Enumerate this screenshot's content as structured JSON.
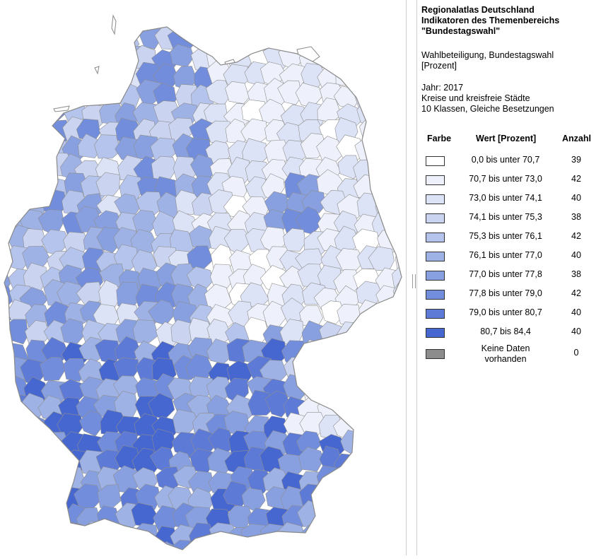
{
  "header": {
    "title_lines": [
      "Regionalatlas Deutschland",
      "Indikatoren des Themenbereichs",
      "\"Bundestagswahl\""
    ],
    "indicator_lines": [
      "Wahlbeteiligung, Bundestagswahl",
      "[Prozent]"
    ],
    "meta_lines": [
      "Jahr: 2017",
      "Kreise und kreisfreie Städte",
      "10 Klassen, Gleiche Besetzungen"
    ]
  },
  "legend": {
    "col_color": "Farbe",
    "col_value": "Wert [Prozent]",
    "col_count": "Anzahl",
    "classes": [
      {
        "label": "0,0 bis unter 70,7",
        "count": "39",
        "color": "#ffffff"
      },
      {
        "label": "70,7 bis unter 73,0",
        "count": "42",
        "color": "#eef1fb"
      },
      {
        "label": "73,0 bis unter 74,1",
        "count": "40",
        "color": "#dde3f6"
      },
      {
        "label": "74,1 bis unter 75,3",
        "count": "38",
        "color": "#cad4f1"
      },
      {
        "label": "75,3 bis unter 76,1",
        "count": "42",
        "color": "#b5c4ec"
      },
      {
        "label": "76,1 bis unter 77,0",
        "count": "40",
        "color": "#9fb2e6"
      },
      {
        "label": "77,0 bis unter 77,8",
        "count": "38",
        "color": "#88a0e0"
      },
      {
        "label": "77,8 bis unter 79,0",
        "count": "42",
        "color": "#728ddb"
      },
      {
        "label": "79,0 bis unter 80,7",
        "count": "40",
        "color": "#5c7ad6"
      },
      {
        "label": "80,7 bis 84,4",
        "count": "40",
        "color": "#4666d0"
      }
    ],
    "nodata": {
      "label_lines": [
        "Keine Daten",
        "vorhanden"
      ],
      "count": "0",
      "color": "#8c8c8c"
    }
  }
}
